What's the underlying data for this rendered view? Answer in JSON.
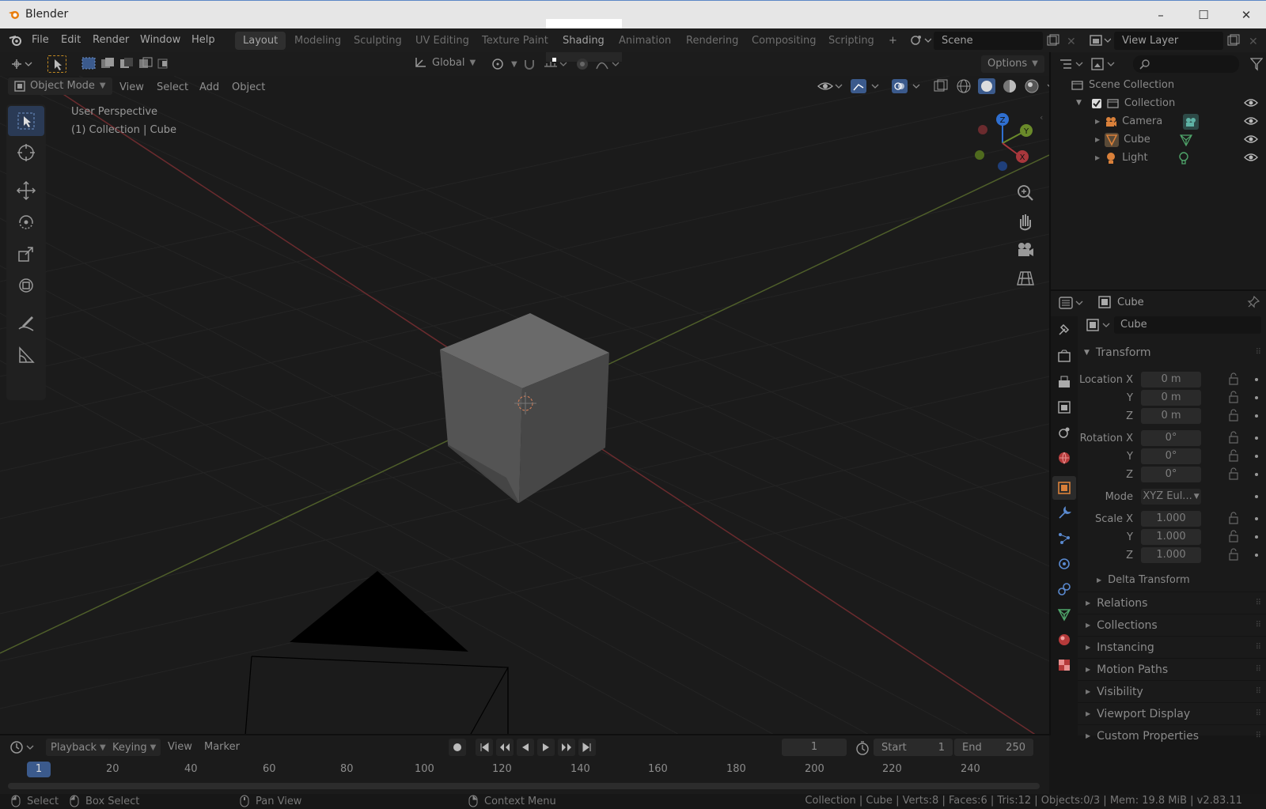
{
  "window": {
    "title": "Blender",
    "controls": [
      "–",
      "☐",
      "✕"
    ]
  },
  "menu": {
    "items": [
      "File",
      "Edit",
      "Render",
      "Window",
      "Help"
    ],
    "workspaces": [
      "Layout",
      "Modeling",
      "Sculpting",
      "UV Editing",
      "Texture Paint",
      "Shading",
      "Animation",
      "Rendering",
      "Compositing",
      "Scripting"
    ],
    "active_workspace": "Layout",
    "add_workspace": "+",
    "scene": "Scene",
    "view_layer": "View Layer"
  },
  "header": {
    "orientation": "Global",
    "options": "Options"
  },
  "viewport": {
    "mode": "Object Mode",
    "menus": [
      "View",
      "Select",
      "Add",
      "Object"
    ],
    "perspective_label": "User Perspective",
    "context_label": "(1) Collection | Cube",
    "gizmo_axes": {
      "x": "X",
      "y": "Y",
      "z": "Z"
    }
  },
  "outliner": {
    "root": "Scene Collection",
    "collection": "Collection",
    "objects": [
      "Camera",
      "Cube",
      "Light"
    ]
  },
  "properties": {
    "object_name": "Cube",
    "data_name": "Cube",
    "transform_title": "Transform",
    "location": {
      "label_x": "Location X",
      "label_y": "Y",
      "label_z": "Z",
      "x": "0 m",
      "y": "0 m",
      "z": "0 m"
    },
    "rotation": {
      "label_x": "Rotation X",
      "label_y": "Y",
      "label_z": "Z",
      "x": "0°",
      "y": "0°",
      "z": "0°"
    },
    "mode": {
      "label": "Mode",
      "value": "XYZ Eul..."
    },
    "scale": {
      "label_x": "Scale X",
      "label_y": "Y",
      "label_z": "Z",
      "x": "1.000",
      "y": "1.000",
      "z": "1.000"
    },
    "delta_transform": "Delta Transform",
    "panels": [
      "Relations",
      "Collections",
      "Instancing",
      "Motion Paths",
      "Visibility",
      "Viewport Display",
      "Custom Properties"
    ]
  },
  "timeline": {
    "menus": [
      "Playback",
      "Keying",
      "View",
      "Marker"
    ],
    "current_frame": "1",
    "start_label": "Start",
    "start": "1",
    "end_label": "End",
    "end": "250",
    "ruler": [
      "1",
      "20",
      "40",
      "60",
      "80",
      "100",
      "120",
      "140",
      "160",
      "180",
      "200",
      "220",
      "240"
    ]
  },
  "status": {
    "select": "Select",
    "box_select": "Box Select",
    "pan_view": "Pan View",
    "context_menu": "Context Menu",
    "stats": "Collection | Cube | Verts:8 | Faces:6 | Tris:12 | Objects:0/3 | Mem: 19.8 MiB | v2.83.11"
  },
  "colors": {
    "x_axis": "#a8373c",
    "y_axis": "#6a8a2a",
    "z_axis": "#2f6fd0",
    "active_tool": "#2a3a55"
  }
}
